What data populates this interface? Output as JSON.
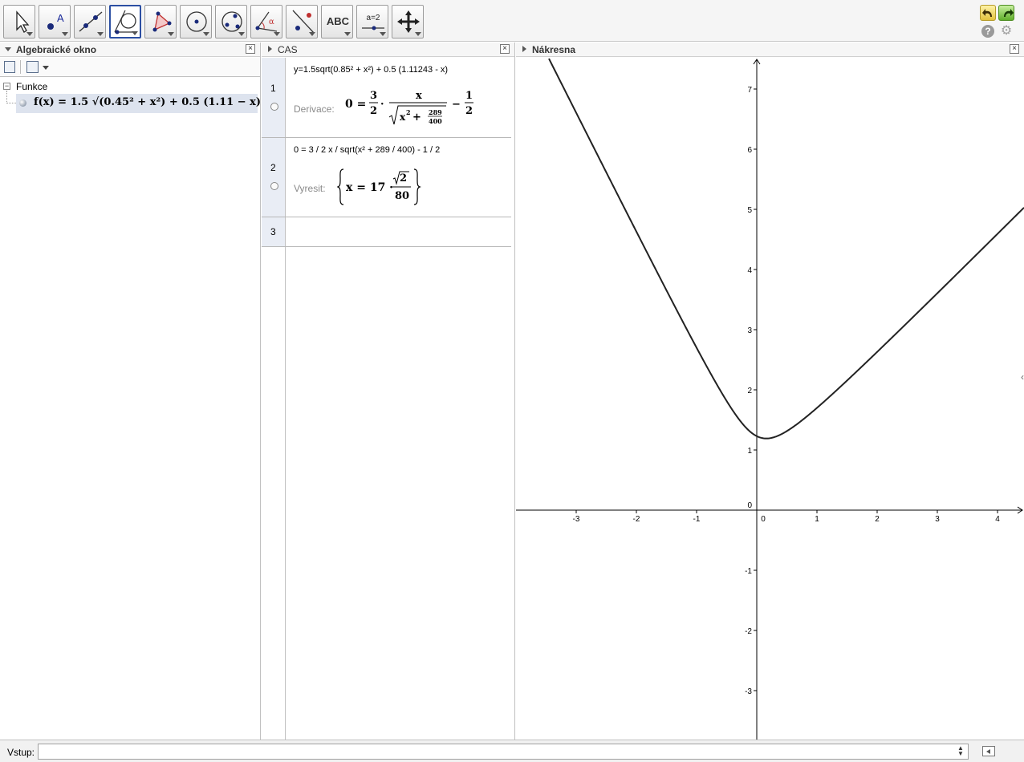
{
  "toolbar": {
    "tools": [
      {
        "name": "move-tool",
        "selected": false
      },
      {
        "name": "point-tool",
        "selected": false
      },
      {
        "name": "line-tool",
        "selected": false
      },
      {
        "name": "tangent-tool",
        "selected": true
      },
      {
        "name": "polygon-tool",
        "selected": false
      },
      {
        "name": "circle-tool",
        "selected": false
      },
      {
        "name": "conic-tool",
        "selected": false
      },
      {
        "name": "angle-tool",
        "selected": false
      },
      {
        "name": "reflect-tool",
        "selected": false
      },
      {
        "name": "text-tool",
        "selected": false,
        "label": "ABC"
      },
      {
        "name": "slider-tool",
        "selected": false,
        "label": "a=2"
      },
      {
        "name": "move-view-tool",
        "selected": false
      }
    ],
    "help_label": "?"
  },
  "algebra": {
    "title": "Algebraické okno",
    "folder": "Funkce",
    "items": [
      {
        "expr": "f(x) = 1.5 √(0.45² + x²) + 0.5 (1.11 − x)"
      }
    ]
  },
  "cas": {
    "title": "CAS",
    "rows": [
      {
        "number": "1",
        "input": "y=1.5sqrt(0.85² + x²) + 0.5 (1.11243 - x)",
        "command": "Derivace:",
        "output": "0 = 3/2 · x / √(x² + 289/400) − 1/2"
      },
      {
        "number": "2",
        "input": "0 = 3 / 2 x / sqrt(x² + 289 / 400) - 1 / 2",
        "command": "Vyresit:",
        "output": "{x = 17 · √2/80}"
      },
      {
        "number": "3",
        "input": "",
        "command": "",
        "output": ""
      }
    ]
  },
  "graphics": {
    "title": "Nákresna",
    "chart_data": {
      "type": "line",
      "function": "f(x) = 1.5 sqrt(0.45^2 + x^2) + 0.5 (1.11 - x)",
      "x_ticks": [
        "-3",
        "-2",
        "-1",
        "0",
        "1",
        "2",
        "3",
        "4"
      ],
      "y_ticks": [
        "-3",
        "-2",
        "-1",
        "0",
        "1",
        "2",
        "3",
        "4",
        "5",
        "6",
        "7"
      ],
      "xlim": [
        -4.0,
        4.3
      ],
      "ylim": [
        -3.8,
        7.5
      ],
      "sampled_points": [
        {
          "x": -3.5,
          "y": 7.6
        },
        {
          "x": -3.0,
          "y": 5.61
        },
        {
          "x": -2.0,
          "y": 4.13
        },
        {
          "x": -1.0,
          "y": 2.7
        },
        {
          "x": -0.5,
          "y": 1.81
        },
        {
          "x": 0.0,
          "y": 1.23
        },
        {
          "x": 0.15,
          "y": 1.19
        },
        {
          "x": 0.5,
          "y": 1.31
        },
        {
          "x": 1.0,
          "y": 1.69
        },
        {
          "x": 2.0,
          "y": 2.63
        },
        {
          "x": 3.0,
          "y": 3.6
        },
        {
          "x": 4.0,
          "y": 4.59
        }
      ],
      "grid": false,
      "line_color": "#222222"
    }
  },
  "input_bar": {
    "label": "Vstup:",
    "value": ""
  }
}
